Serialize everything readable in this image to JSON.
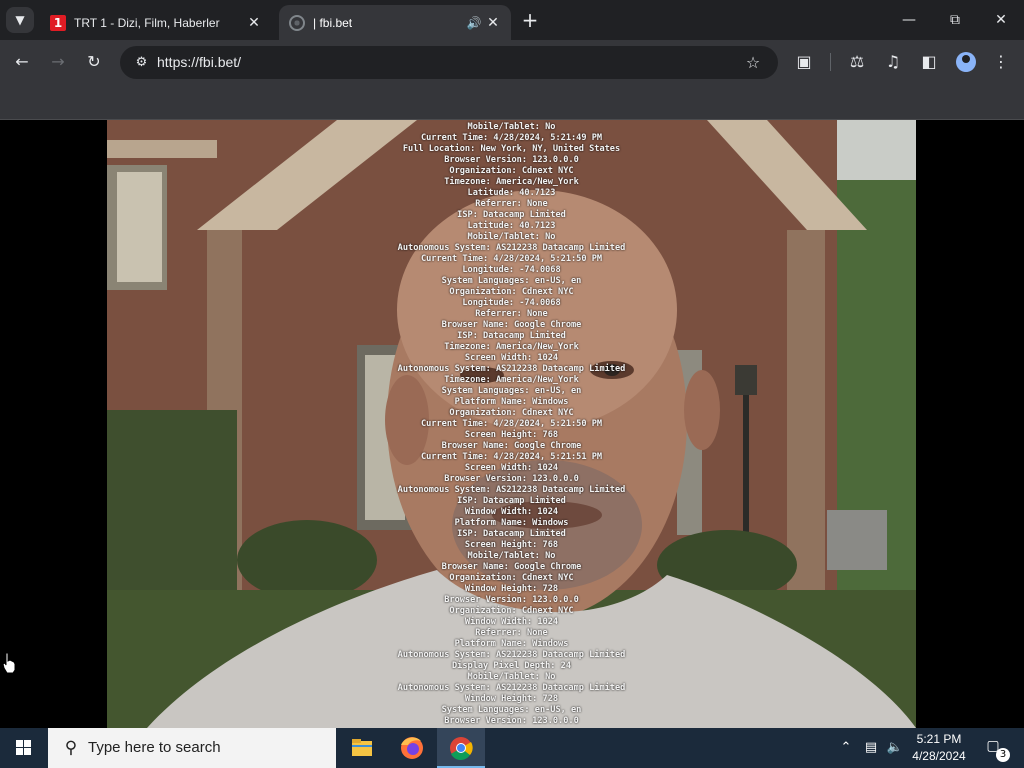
{
  "browser": {
    "tabs": [
      {
        "title": "TRT 1 - Dizi, Film, Haberler",
        "favicon": "trt-icon",
        "active": false
      },
      {
        "title": "| fbi.bet",
        "favicon": "globe-icon",
        "active": true,
        "audio": true
      }
    ],
    "favicon_text": "1",
    "url": "https://fbi.bet/"
  },
  "page": {
    "log_lines": [
      "Mobile/Tablet: No",
      "Current Time: 4/28/2024, 5:21:49 PM",
      "Full Location: New York, NY, United States",
      "Browser Version: 123.0.0.0",
      "Organization: Cdnext NYC",
      "Timezone: America/New_York",
      "Latitude: 40.7123",
      "Referrer: None",
      "ISP: Datacamp Limited",
      "Latitude: 40.7123",
      "Mobile/Tablet: No",
      "Autonomous System: AS212238 Datacamp Limited",
      "Current Time: 4/28/2024, 5:21:50 PM",
      "Longitude: -74.0068",
      "System Languages: en-US, en",
      "Organization: Cdnext NYC",
      "Longitude: -74.0068",
      "Referrer: None",
      "Browser Name: Google Chrome",
      "ISP: Datacamp Limited",
      "Timezone: America/New_York",
      "Screen Width: 1024",
      "Autonomous System: AS212238 Datacamp Limited",
      "Timezone: America/New_York",
      "System Languages: en-US, en",
      "Platform Name: Windows",
      "Organization: Cdnext NYC",
      "Current Time: 4/28/2024, 5:21:50 PM",
      "Screen Height: 768",
      "Browser Name: Google Chrome",
      "Current Time: 4/28/2024, 5:21:51 PM",
      "Screen Width: 1024",
      "Browser Version: 123.0.0.0",
      "Autonomous System: AS212238 Datacamp Limited",
      "ISP: Datacamp Limited",
      "Window Width: 1024",
      "Platform Name: Windows",
      "ISP: Datacamp Limited",
      "Screen Height: 768",
      "Mobile/Tablet: No",
      "Browser Name: Google Chrome",
      "Organization: Cdnext NYC",
      "Window Height: 728",
      "Browser Version: 123.0.0.0",
      "Organization: Cdnext NYC",
      "Window Width: 1024",
      "Referrer: None",
      "Platform Name: Windows",
      "Autonomous System: AS212238 Datacamp Limited",
      "Display Pixel Depth: 24",
      "Mobile/Tablet: No",
      "Autonomous System: AS212238 Datacamp Limited",
      "Window Height: 728",
      "System Languages: en-US, en",
      "Browser Version: 123.0.0.0"
    ]
  },
  "taskbar": {
    "search_placeholder": "Type here to search",
    "apps": [
      "file-explorer-icon",
      "firefox-icon",
      "chrome-icon"
    ],
    "clock_time": "5:21 PM",
    "clock_date": "4/28/2024",
    "notification_count": "3"
  },
  "colors": {
    "tab_strip": "#202124",
    "toolbar": "#35363a",
    "taskbar": "#1b2a3b",
    "trt_red": "#e01c24"
  }
}
